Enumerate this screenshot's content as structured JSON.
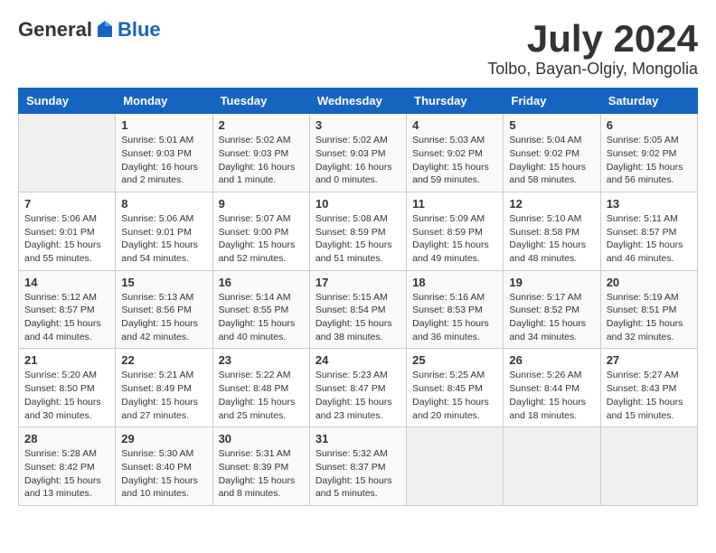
{
  "header": {
    "logo_general": "General",
    "logo_blue": "Blue",
    "month": "July 2024",
    "location": "Tolbo, Bayan-Olgiy, Mongolia"
  },
  "weekdays": [
    "Sunday",
    "Monday",
    "Tuesday",
    "Wednesday",
    "Thursday",
    "Friday",
    "Saturday"
  ],
  "weeks": [
    [
      {
        "day": "",
        "info": ""
      },
      {
        "day": "1",
        "info": "Sunrise: 5:01 AM\nSunset: 9:03 PM\nDaylight: 16 hours\nand 2 minutes."
      },
      {
        "day": "2",
        "info": "Sunrise: 5:02 AM\nSunset: 9:03 PM\nDaylight: 16 hours\nand 1 minute."
      },
      {
        "day": "3",
        "info": "Sunrise: 5:02 AM\nSunset: 9:03 PM\nDaylight: 16 hours\nand 0 minutes."
      },
      {
        "day": "4",
        "info": "Sunrise: 5:03 AM\nSunset: 9:02 PM\nDaylight: 15 hours\nand 59 minutes."
      },
      {
        "day": "5",
        "info": "Sunrise: 5:04 AM\nSunset: 9:02 PM\nDaylight: 15 hours\nand 58 minutes."
      },
      {
        "day": "6",
        "info": "Sunrise: 5:05 AM\nSunset: 9:02 PM\nDaylight: 15 hours\nand 56 minutes."
      }
    ],
    [
      {
        "day": "7",
        "info": "Sunrise: 5:06 AM\nSunset: 9:01 PM\nDaylight: 15 hours\nand 55 minutes."
      },
      {
        "day": "8",
        "info": "Sunrise: 5:06 AM\nSunset: 9:01 PM\nDaylight: 15 hours\nand 54 minutes."
      },
      {
        "day": "9",
        "info": "Sunrise: 5:07 AM\nSunset: 9:00 PM\nDaylight: 15 hours\nand 52 minutes."
      },
      {
        "day": "10",
        "info": "Sunrise: 5:08 AM\nSunset: 8:59 PM\nDaylight: 15 hours\nand 51 minutes."
      },
      {
        "day": "11",
        "info": "Sunrise: 5:09 AM\nSunset: 8:59 PM\nDaylight: 15 hours\nand 49 minutes."
      },
      {
        "day": "12",
        "info": "Sunrise: 5:10 AM\nSunset: 8:58 PM\nDaylight: 15 hours\nand 48 minutes."
      },
      {
        "day": "13",
        "info": "Sunrise: 5:11 AM\nSunset: 8:57 PM\nDaylight: 15 hours\nand 46 minutes."
      }
    ],
    [
      {
        "day": "14",
        "info": "Sunrise: 5:12 AM\nSunset: 8:57 PM\nDaylight: 15 hours\nand 44 minutes."
      },
      {
        "day": "15",
        "info": "Sunrise: 5:13 AM\nSunset: 8:56 PM\nDaylight: 15 hours\nand 42 minutes."
      },
      {
        "day": "16",
        "info": "Sunrise: 5:14 AM\nSunset: 8:55 PM\nDaylight: 15 hours\nand 40 minutes."
      },
      {
        "day": "17",
        "info": "Sunrise: 5:15 AM\nSunset: 8:54 PM\nDaylight: 15 hours\nand 38 minutes."
      },
      {
        "day": "18",
        "info": "Sunrise: 5:16 AM\nSunset: 8:53 PM\nDaylight: 15 hours\nand 36 minutes."
      },
      {
        "day": "19",
        "info": "Sunrise: 5:17 AM\nSunset: 8:52 PM\nDaylight: 15 hours\nand 34 minutes."
      },
      {
        "day": "20",
        "info": "Sunrise: 5:19 AM\nSunset: 8:51 PM\nDaylight: 15 hours\nand 32 minutes."
      }
    ],
    [
      {
        "day": "21",
        "info": "Sunrise: 5:20 AM\nSunset: 8:50 PM\nDaylight: 15 hours\nand 30 minutes."
      },
      {
        "day": "22",
        "info": "Sunrise: 5:21 AM\nSunset: 8:49 PM\nDaylight: 15 hours\nand 27 minutes."
      },
      {
        "day": "23",
        "info": "Sunrise: 5:22 AM\nSunset: 8:48 PM\nDaylight: 15 hours\nand 25 minutes."
      },
      {
        "day": "24",
        "info": "Sunrise: 5:23 AM\nSunset: 8:47 PM\nDaylight: 15 hours\nand 23 minutes."
      },
      {
        "day": "25",
        "info": "Sunrise: 5:25 AM\nSunset: 8:45 PM\nDaylight: 15 hours\nand 20 minutes."
      },
      {
        "day": "26",
        "info": "Sunrise: 5:26 AM\nSunset: 8:44 PM\nDaylight: 15 hours\nand 18 minutes."
      },
      {
        "day": "27",
        "info": "Sunrise: 5:27 AM\nSunset: 8:43 PM\nDaylight: 15 hours\nand 15 minutes."
      }
    ],
    [
      {
        "day": "28",
        "info": "Sunrise: 5:28 AM\nSunset: 8:42 PM\nDaylight: 15 hours\nand 13 minutes."
      },
      {
        "day": "29",
        "info": "Sunrise: 5:30 AM\nSunset: 8:40 PM\nDaylight: 15 hours\nand 10 minutes."
      },
      {
        "day": "30",
        "info": "Sunrise: 5:31 AM\nSunset: 8:39 PM\nDaylight: 15 hours\nand 8 minutes."
      },
      {
        "day": "31",
        "info": "Sunrise: 5:32 AM\nSunset: 8:37 PM\nDaylight: 15 hours\nand 5 minutes."
      },
      {
        "day": "",
        "info": ""
      },
      {
        "day": "",
        "info": ""
      },
      {
        "day": "",
        "info": ""
      }
    ]
  ]
}
